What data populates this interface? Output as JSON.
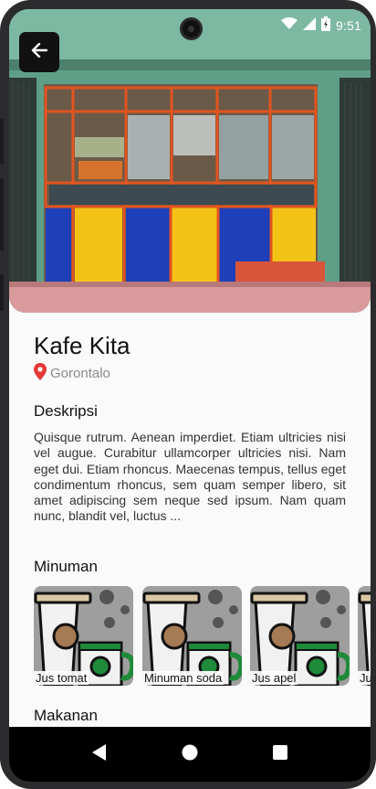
{
  "status_bar": {
    "time": "9:51"
  },
  "place": {
    "name": "Kafe Kita",
    "location": "Gorontalo"
  },
  "description": {
    "heading": "Deskripsi",
    "text": "Quisque rutrum. Aenean imperdiet. Etiam ultricies nisi vel augue. Curabitur ullamcorper ultricies nisi. Nam eget dui. Etiam rhoncus. Maecenas tempus, tellus eget condimentum rhoncus, sem quam semper libero, sit amet adipiscing sem neque sed ipsum. Nam quam nunc, blandit vel, luctus ..."
  },
  "drinks": {
    "heading": "Minuman",
    "items": [
      {
        "label": "Jus tomat"
      },
      {
        "label": "Minuman soda"
      },
      {
        "label": "Jus apel"
      },
      {
        "label": "Ju"
      }
    ]
  },
  "food": {
    "heading": "Makanan"
  },
  "colors": {
    "accent_pin": "#e53935",
    "card_bg": "#9e9e9e",
    "cup_green": "#1e8a3a"
  },
  "icons": {
    "back": "arrow-left-icon",
    "pin": "location-pin-icon",
    "wifi": "wifi-icon",
    "signal": "signal-icon",
    "battery": "battery-icon",
    "nav_back": "triangle-back-icon",
    "nav_home": "circle-home-icon",
    "nav_recents": "square-recents-icon"
  }
}
